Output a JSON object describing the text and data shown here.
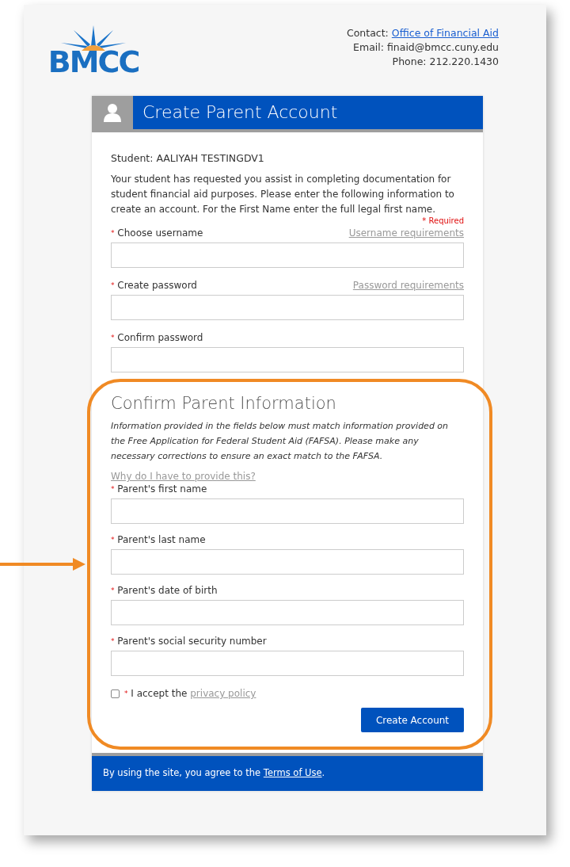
{
  "header": {
    "logo_text": "BMCC",
    "contact_label": "Contact:",
    "contact_link": "Office of Financial Aid",
    "email": "Email: finaid@bmcc.cuny.edu",
    "phone": "Phone:  212.220.1430"
  },
  "card": {
    "title": "Create Parent Account",
    "student": "Student: AALIYAH TESTINGDV1",
    "intro": "Your student has requested you assist in completing documentation for student financial aid purposes. Please enter the following information to create an account. For the First Name enter the full legal first name.",
    "required_note": {
      "marker": "*",
      "text": "Required"
    },
    "account_fields": [
      {
        "marker": "*",
        "label": "Choose username",
        "help_link": "Username requirements"
      },
      {
        "marker": "*",
        "label": "Create password",
        "help_link": "Password requirements"
      },
      {
        "marker": "*",
        "label": "Confirm password"
      }
    ],
    "section_title": "Confirm Parent Information",
    "section_note": "Information provided in the fields below must match information provided on the Free Application for Federal Student Aid (FAFSA). Please make any necessary corrections to ensure an exact match to the FAFSA.",
    "why_link": "Why do I have to provide this?",
    "parent_fields": [
      {
        "marker": "*",
        "label": "Parent's first name"
      },
      {
        "marker": "*",
        "label": "Parent's last name"
      },
      {
        "marker": "*",
        "label": "Parent's date of birth"
      },
      {
        "marker": "*",
        "label": "Parent's social security number"
      }
    ],
    "accept": {
      "checked": false,
      "marker": "*",
      "text": "I accept the",
      "link": "privacy policy"
    },
    "submit": "Create Account"
  },
  "footer": {
    "text": "By using the site, you agree to the",
    "link": "Terms of Use",
    "end": "."
  }
}
